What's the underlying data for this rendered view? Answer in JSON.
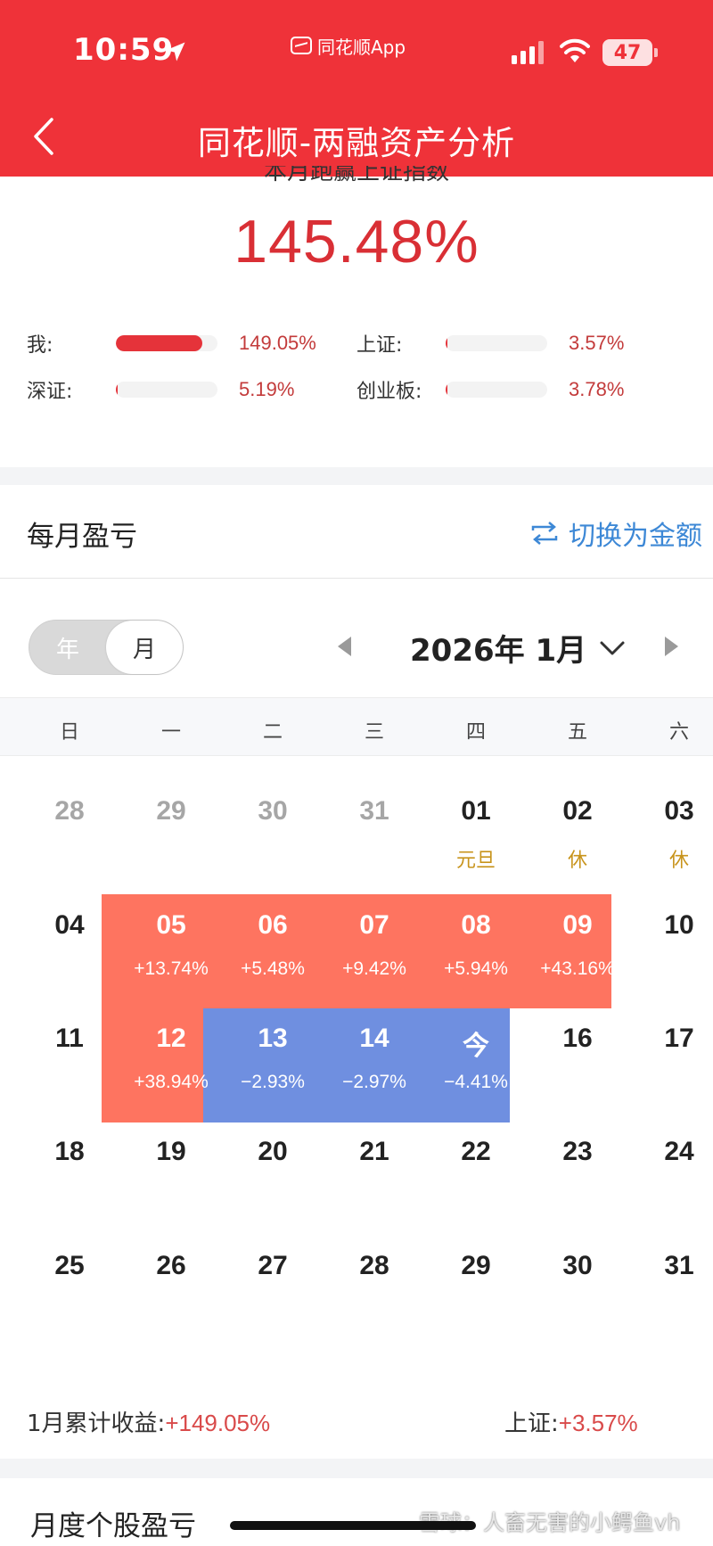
{
  "status_bar": {
    "time": "10:59",
    "app_name": "同花顺App",
    "battery": "47"
  },
  "header": {
    "title": "同花顺-两融资产分析"
  },
  "beat_index": {
    "subtitle": "本月跑赢上证指数",
    "value": "145.48%",
    "comparisons": [
      {
        "label": "我:",
        "value": "149.05%",
        "fill": 0.85
      },
      {
        "label": "上证:",
        "value": "3.57%",
        "fill": 0.02
      },
      {
        "label": "深证:",
        "value": "5.19%",
        "fill": 0.02
      },
      {
        "label": "创业板:",
        "value": "3.78%",
        "fill": 0.02
      }
    ]
  },
  "monthly": {
    "title": "每月盈亏",
    "switch_label": "切换为金额",
    "toggle": {
      "year": "年",
      "month": "月",
      "selected": "月"
    },
    "current_month": "2026年 1月",
    "weekdays": [
      "日",
      "一",
      "二",
      "三",
      "四",
      "五",
      "六"
    ],
    "weeks": [
      [
        {
          "d": "28",
          "muted": true
        },
        {
          "d": "29",
          "muted": true
        },
        {
          "d": "30",
          "muted": true
        },
        {
          "d": "31",
          "muted": true
        },
        {
          "d": "01",
          "note": "元旦"
        },
        {
          "d": "02",
          "note": "休"
        },
        {
          "d": "03",
          "note": "休"
        }
      ],
      [
        {
          "d": "04"
        },
        {
          "d": "05",
          "pct": "+13.74%",
          "state": "up"
        },
        {
          "d": "06",
          "pct": "+5.48%",
          "state": "up"
        },
        {
          "d": "07",
          "pct": "+9.42%",
          "state": "up"
        },
        {
          "d": "08",
          "pct": "+5.94%",
          "state": "up"
        },
        {
          "d": "09",
          "pct": "+43.16%",
          "state": "up"
        },
        {
          "d": "10"
        }
      ],
      [
        {
          "d": "11"
        },
        {
          "d": "12",
          "pct": "+38.94%",
          "state": "up"
        },
        {
          "d": "13",
          "pct": "−2.93%",
          "state": "down"
        },
        {
          "d": "14",
          "pct": "−2.97%",
          "state": "down"
        },
        {
          "d": "今",
          "pct": "−4.41%",
          "state": "down"
        },
        {
          "d": "16"
        },
        {
          "d": "17"
        }
      ],
      [
        {
          "d": "18"
        },
        {
          "d": "19"
        },
        {
          "d": "20"
        },
        {
          "d": "21"
        },
        {
          "d": "22"
        },
        {
          "d": "23"
        },
        {
          "d": "24"
        }
      ],
      [
        {
          "d": "25"
        },
        {
          "d": "26"
        },
        {
          "d": "27"
        },
        {
          "d": "28"
        },
        {
          "d": "29"
        },
        {
          "d": "30"
        },
        {
          "d": "31"
        }
      ]
    ],
    "summary_label": "1月累计收益:",
    "summary_value": "+149.05%",
    "index_label": "上证:",
    "index_value": "+3.57%"
  },
  "stock_section": {
    "title": "月度个股盈亏"
  },
  "watermark": "雪球：人畜无害的小鳄鱼vh",
  "colors": {
    "header": "#ef3239",
    "up": "#fe7460",
    "down": "#6f8fe0",
    "link": "#3d88d6",
    "holiday": "#c8941c"
  }
}
